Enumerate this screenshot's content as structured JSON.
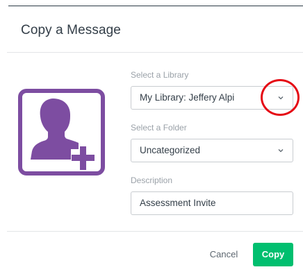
{
  "dialog": {
    "title": "Copy a Message"
  },
  "colors": {
    "accent_purple": "#7d4da1",
    "primary_button": "#00bf6f",
    "annotation_red": "#e50914"
  },
  "icons": {
    "avatar": "add-user-icon",
    "dropdown": "chevron-down-icon"
  },
  "form": {
    "library": {
      "label": "Select a Library",
      "value": "My Library: Jeffery Alpi"
    },
    "folder": {
      "label": "Select a Folder",
      "value": "Uncategorized"
    },
    "description": {
      "label": "Description",
      "value": "Assessment Invite"
    }
  },
  "buttons": {
    "cancel": "Cancel",
    "copy": "Copy"
  }
}
